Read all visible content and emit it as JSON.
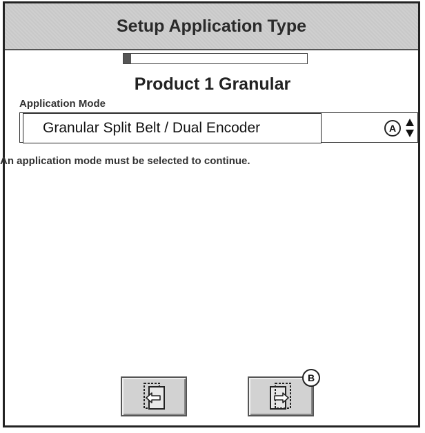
{
  "title": "Setup Application Type",
  "progress": {
    "fraction": 0.04
  },
  "product_title": "Product 1 Granular",
  "application_mode": {
    "label": "Application Mode",
    "selected_value": "Granular Split Belt / Dual Encoder",
    "callout": "A"
  },
  "warning": "An application mode must be selected to continue.",
  "nav": {
    "back_icon": "back-arrow-icon",
    "next_icon": "next-arrow-icon",
    "next_callout": "B"
  }
}
